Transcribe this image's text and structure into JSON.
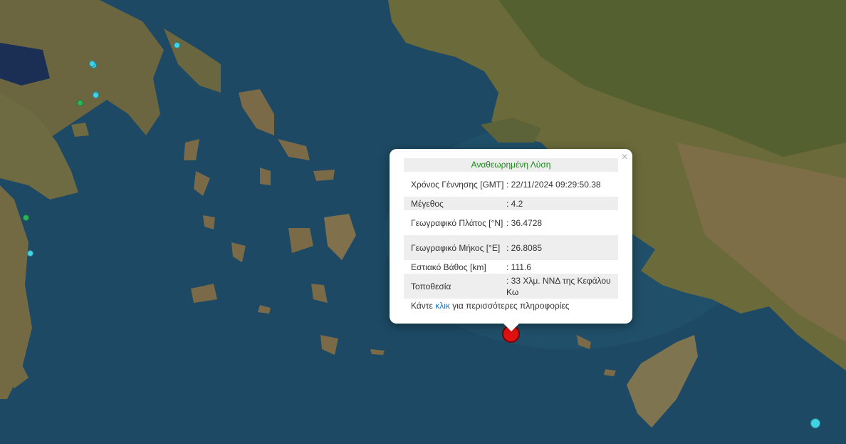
{
  "map": {
    "markers": [
      {
        "name": "quake-marker",
        "color": "#3fd3e6",
        "size": 9
      },
      {
        "name": "quake-marker",
        "color": "#3fd3e6",
        "size": 9
      },
      {
        "name": "quake-marker",
        "color": "#3fd3e6",
        "size": 9
      },
      {
        "name": "quake-marker",
        "color": "#3fd3e6",
        "size": 9
      },
      {
        "name": "quake-marker",
        "color": "#3fd3e6",
        "size": 9
      },
      {
        "name": "quake-marker",
        "color": "#3fd3e6",
        "size": 9
      },
      {
        "name": "quake-marker",
        "color": "#2bb55a",
        "size": 9
      },
      {
        "name": "quake-marker",
        "color": "#2bb55a",
        "size": 9
      },
      {
        "name": "quake-marker",
        "color": "#3fd3e6",
        "size": 14
      }
    ],
    "main_marker_color": "#e11111"
  },
  "popup": {
    "title": "Αναθεωρημένη Λύση",
    "close": "×",
    "rows": [
      {
        "label": "Χρόνος Γέννησης [GMT]",
        "value": ": 22/11/2024 09:29:50.38"
      },
      {
        "label": "Μέγεθος",
        "value": ": 4.2"
      },
      {
        "label": "Γεωγραφικό Πλάτος [°N]",
        "value": ": 36.4728"
      },
      {
        "label": "Γεωγραφικό Μήκος [°E]",
        "value": ": 26.8085"
      },
      {
        "label": "Εστιακό Βάθος [km]",
        "value": ": 111.6"
      },
      {
        "label": "Τοποθεσία",
        "value": ": 33 Χλμ. ΝΝΔ της Κεφάλου Κω"
      }
    ],
    "more_prefix": "Κάντε ",
    "more_link": "κλικ",
    "more_suffix": " για περισσότερες πληροφορίες"
  }
}
